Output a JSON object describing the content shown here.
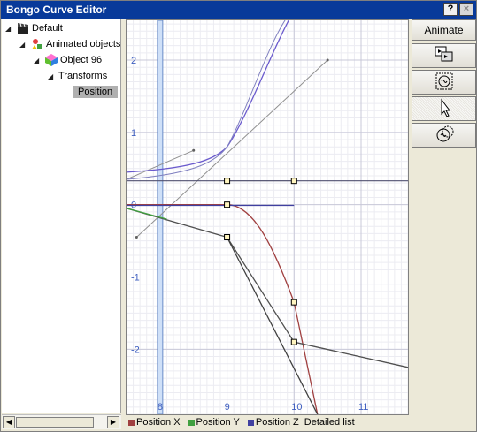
{
  "window": {
    "title": "Bongo Curve Editor",
    "help_label": "?",
    "close_label": "×"
  },
  "tree": {
    "items": [
      {
        "label": "Default",
        "icon": "clapperboard-icon",
        "level": 0
      },
      {
        "label": "Animated objects",
        "icon": "animated-objects-icon",
        "level": 1
      },
      {
        "label": "Object 96",
        "icon": "object-cube-icon",
        "level": 2
      },
      {
        "label": "Transforms",
        "icon": "",
        "level": 3
      },
      {
        "label": "Position",
        "icon": "",
        "level": 4,
        "selected": true
      }
    ]
  },
  "toolbar": {
    "animate_label": "Animate",
    "buttons": [
      "animate-button",
      "copy-keys-icon",
      "loop-curve-icon",
      "select-arrow-icon",
      "curve-tool-icon"
    ]
  },
  "legend": {
    "items": [
      {
        "label": "Position X",
        "color": "#a04040"
      },
      {
        "label": "Position Y",
        "color": "#40a040"
      },
      {
        "label": "Position Z",
        "color": "#4040a0"
      }
    ],
    "detailed_label": "Detailed list"
  },
  "chart_data": {
    "type": "line",
    "x_ticks": [
      "8",
      "9",
      "10",
      "11"
    ],
    "y_ticks": [
      "2",
      "1",
      "0",
      "-1",
      "-2"
    ],
    "xlim": [
      7.5,
      11.7
    ],
    "ylim": [
      -2.9,
      2.55
    ],
    "current_frame": 8.0,
    "grid": true,
    "series": [
      {
        "name": "Position X",
        "color": "#a04040",
        "keys": [
          [
            9,
            0.0
          ],
          [
            10,
            -1.35
          ]
        ]
      },
      {
        "name": "Position Y",
        "color": "#40a040",
        "keys": [
          [
            7.5,
            -0.05
          ],
          [
            9,
            -0.45
          ],
          [
            10,
            -1.9
          ]
        ]
      },
      {
        "name": "Position Z",
        "color": "#4040a0",
        "keys": [
          [
            9,
            0.33
          ],
          [
            10,
            0.33
          ]
        ]
      }
    ]
  }
}
